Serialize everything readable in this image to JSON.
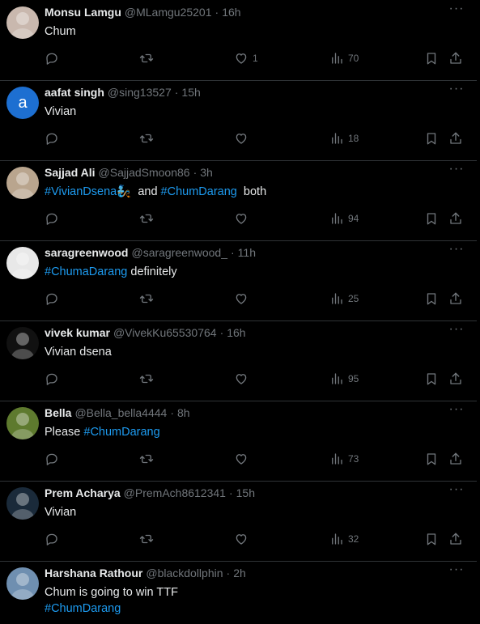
{
  "tweets": [
    {
      "name": "Monsu Lamgu",
      "handle": "@MLamgu25201",
      "sep": "·",
      "time": "16h",
      "avatar": {
        "type": "photo",
        "bg": "#c9b8ae"
      },
      "text": [
        {
          "t": "Chum",
          "tag": false
        }
      ],
      "likes": "1",
      "views": "70"
    },
    {
      "name": "aafat singh",
      "handle": "@sing13527",
      "sep": "·",
      "time": "15h",
      "avatar": {
        "type": "letter",
        "letter": "a",
        "bg": "#1d6fd1"
      },
      "text": [
        {
          "t": "Vivian",
          "tag": false
        }
      ],
      "likes": "",
      "views": "18"
    },
    {
      "name": "Sajjad Ali",
      "handle": "@SajjadSmoon86",
      "sep": "·",
      "time": "3h",
      "avatar": {
        "type": "photo",
        "bg": "#b9a58e"
      },
      "text": [
        {
          "t": "#VivianDsena🧞",
          "tag": true
        },
        {
          "t": "  and ",
          "tag": false
        },
        {
          "t": "#ChumDarang",
          "tag": true
        },
        {
          "t": "  both",
          "tag": false
        }
      ],
      "likes": "",
      "views": "94"
    },
    {
      "name": "saragreenwood",
      "handle": "@saragreenwood_",
      "sep": "·",
      "time": "11h",
      "avatar": {
        "type": "photo",
        "bg": "#e8e8e8"
      },
      "text": [
        {
          "t": "#ChumaDarang",
          "tag": true
        },
        {
          "t": " definitely",
          "tag": false
        }
      ],
      "likes": "",
      "views": "25"
    },
    {
      "name": "vivek kumar",
      "handle": "@VivekKu65530764",
      "sep": "·",
      "time": "16h",
      "avatar": {
        "type": "photo",
        "bg": "#111111"
      },
      "text": [
        {
          "t": "Vivian dsena",
          "tag": false
        }
      ],
      "likes": "",
      "views": "95"
    },
    {
      "name": "Bella",
      "handle": "@Bella_bella4444",
      "sep": "·",
      "time": "8h",
      "avatar": {
        "type": "photo",
        "bg": "#5e7a2e"
      },
      "text": [
        {
          "t": "Please ",
          "tag": false
        },
        {
          "t": "#ChumDarang",
          "tag": true
        }
      ],
      "likes": "",
      "views": "73"
    },
    {
      "name": "Prem Acharya",
      "handle": "@PremAch8612341",
      "sep": "·",
      "time": "15h",
      "avatar": {
        "type": "photo",
        "bg": "#1a2a3a"
      },
      "text": [
        {
          "t": "Vivian",
          "tag": false
        }
      ],
      "likes": "",
      "views": "32"
    },
    {
      "name": "Harshana Rathour",
      "handle": "@blackdollphin",
      "sep": "·",
      "time": "2h",
      "avatar": {
        "type": "photo",
        "bg": "#6f8fb0"
      },
      "text": [
        {
          "t": "Chum is going to win TTF",
          "tag": false
        },
        {
          "t": "#ChumDarang",
          "tag": true,
          "newline": true
        }
      ],
      "likes": "",
      "views": ""
    }
  ],
  "icons": {
    "reply": "reply-icon",
    "retweet": "retweet-icon",
    "like": "heart-icon",
    "views": "views-icon",
    "bookmark": "bookmark-icon",
    "share": "share-icon",
    "more": "more-icon"
  },
  "colors": {
    "background": "#000000",
    "text": "#e7e9ea",
    "muted": "#71767b",
    "link": "#1d9bf0",
    "divider": "#2f3336"
  }
}
